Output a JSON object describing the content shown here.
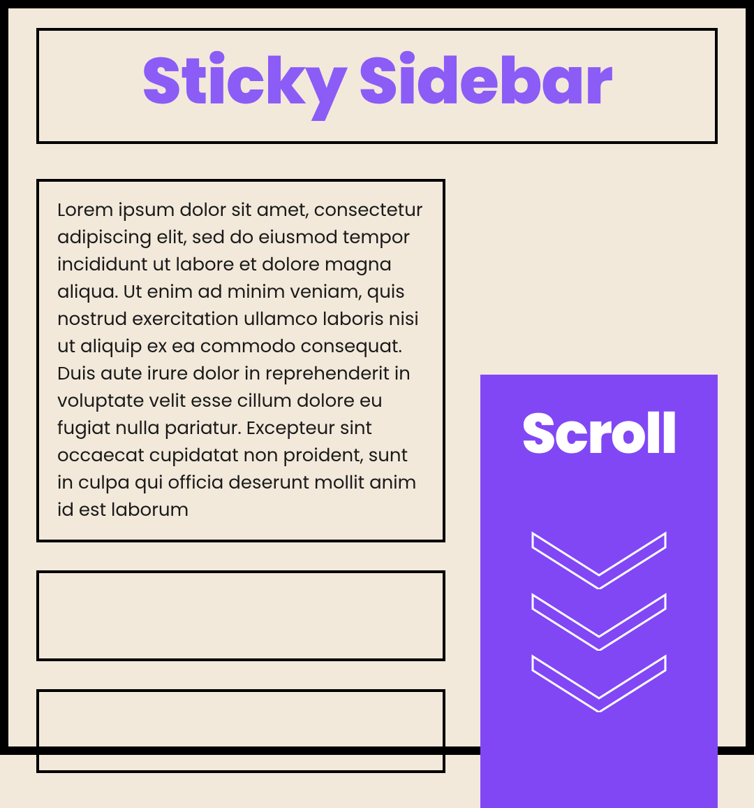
{
  "header": {
    "title": "Sticky Sidebar"
  },
  "main": {
    "paragraph": "Lorem ipsum dolor sit amet, consectetur adipiscing elit, sed do eiusmod tempor incididunt ut labore et dolore magna aliqua. Ut enim ad minim veniam, quis nostrud exercitation ullamco laboris nisi ut aliquip ex ea commodo consequat. Duis aute irure dolor in reprehenderit in voluptate velit esse cillum dolore eu fugiat nulla pariatur. Excepteur sint occaecat cupidatat non proident, sunt in culpa qui officia deserunt mollit anim id est laborum"
  },
  "sidebar": {
    "label": "Scroll"
  },
  "colors": {
    "accent": "#8b5cf6",
    "sidebar_bg": "#8147f5",
    "page_bg": "#f2e9db"
  }
}
